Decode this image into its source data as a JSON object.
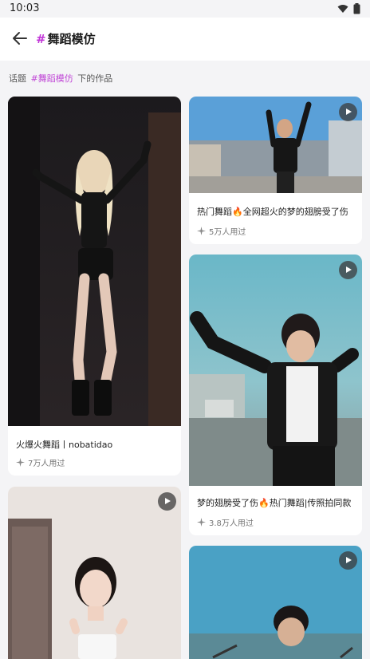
{
  "status": {
    "time": "10:03"
  },
  "header": {
    "hash": "#",
    "title": "舞蹈模仿"
  },
  "subline": {
    "prefix": "话题",
    "topic": "#舞蹈模仿",
    "suffix": "下的作品"
  },
  "cards": [
    {
      "caption": "火爆火舞蹈丨nobatidao",
      "uses": "7万人用过"
    },
    {
      "caption": "热门舞蹈🔥全网超火的梦的翅膀受了伤",
      "uses": "5万人用过"
    },
    {
      "caption": "梦的翅膀受了伤🔥热门舞蹈|传照拍同款",
      "uses": "3.8万人用过"
    },
    {
      "caption": "",
      "uses": ""
    },
    {
      "caption": "",
      "uses": ""
    }
  ]
}
